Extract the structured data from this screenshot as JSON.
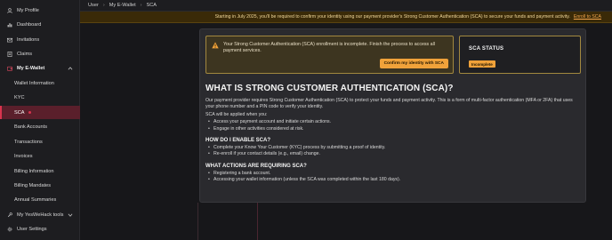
{
  "sidebar": {
    "items": [
      {
        "label": "My Profile",
        "icon": "user-icon"
      },
      {
        "label": "Dashboard",
        "icon": "chart-icon"
      },
      {
        "label": "Invitations",
        "icon": "mail-icon"
      },
      {
        "label": "Claims",
        "icon": "document-icon"
      },
      {
        "label": "My E-Wallet",
        "icon": "wallet-icon"
      },
      {
        "label": "Wallet Information"
      },
      {
        "label": "KYC"
      },
      {
        "label": "SCA"
      },
      {
        "label": "Bank Accounts"
      },
      {
        "label": "Transactions"
      },
      {
        "label": "Invoices"
      },
      {
        "label": "Billing Information"
      },
      {
        "label": "Billing Mandates"
      },
      {
        "label": "Annual Summaries"
      },
      {
        "label": "My YesWeHack tools",
        "icon": "tools-icon"
      },
      {
        "label": "User Settings",
        "icon": "gear-icon"
      }
    ]
  },
  "breadcrumb": [
    "User",
    "My E-Wallet",
    "SCA"
  ],
  "banner": {
    "text": "Starting in July 2025, you'll be required to confirm your identity using our payment provider's Strong Customer Authentication (SCA) to secure your funds and payment activity.",
    "link": "Enroll to SCA"
  },
  "alert": {
    "message": "Your Strong Customer Authentication (SCA) enrollment is incomplete. Finish the process to access all payment services.",
    "button": "Confirm my identity with SCA"
  },
  "status": {
    "title": "SCA STATUS",
    "badge": "Incomplete"
  },
  "content": {
    "heading": "WHAT IS STRONG CUSTOMER AUTHENTICATION (SCA)?",
    "intro": "Our payment provider requires Strong Customer Authentication (SCA) to protect your funds and payment activity. This is a form of multi-factor authentication (MFA or 2FA) that uses your phone number and a PIN code to verify your identity.",
    "applied_when": "SCA will be applied when you:",
    "applied_items": [
      "Access your payment account and initiate certain actions.",
      "Engage in other activities considered at risk."
    ],
    "enable_heading": "HOW DO I ENABLE SCA?",
    "enable_items": [
      "Complete your Know Your Customer (KYC) process by submitting a proof of identity.",
      "Re-enroll if your contact details (e.g., email) change."
    ],
    "actions_heading": "WHAT ACTIONS ARE REQUIRING SCA?",
    "actions_items": [
      "Registering a bank account.",
      "Accessing your wallet information (unless the SCA was completed within the last 180 days)."
    ]
  },
  "colors": {
    "accent": "#d9344e",
    "warning": "#f0a23a"
  }
}
